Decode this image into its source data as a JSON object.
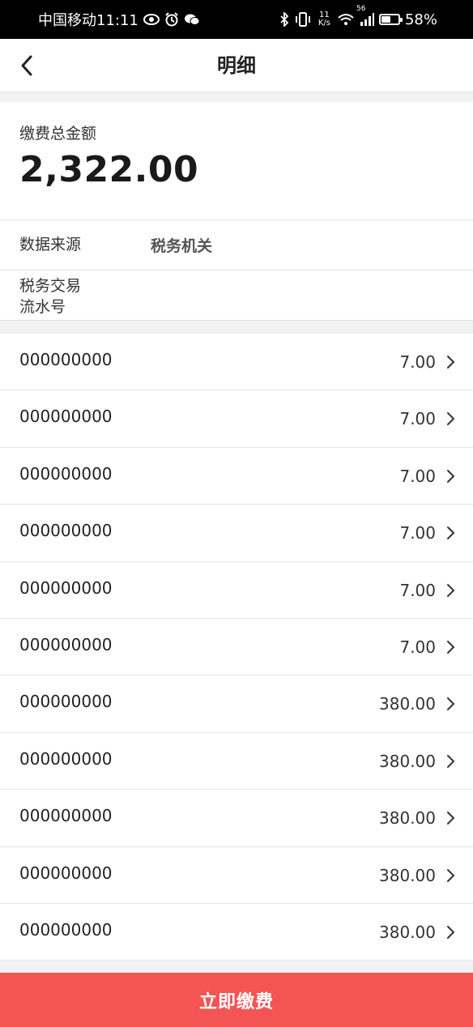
{
  "status_bar": {
    "carrier_time": "中国移动11:11",
    "speed_top": "11",
    "speed_bottom": "K/s",
    "signal_label": "56",
    "battery_percent": "58%",
    "battery_level": 0.58
  },
  "header": {
    "title": "明细"
  },
  "summary": {
    "total_label": "缴费总金额",
    "total_amount": "2,322.00"
  },
  "info": {
    "source_label": "数据来源",
    "source_value": "税务机关",
    "serial_label_line1": "税务交易",
    "serial_label_line2": "流水号",
    "serial_value": ""
  },
  "items": [
    {
      "id": "000000000",
      "amount": "7.00"
    },
    {
      "id": "000000000",
      "amount": "7.00"
    },
    {
      "id": "000000000",
      "amount": "7.00"
    },
    {
      "id": "000000000",
      "amount": "7.00"
    },
    {
      "id": "000000000",
      "amount": "7.00"
    },
    {
      "id": "000000000",
      "amount": "7.00"
    },
    {
      "id": "000000000",
      "amount": "380.00"
    },
    {
      "id": "000000000",
      "amount": "380.00"
    },
    {
      "id": "000000000",
      "amount": "380.00"
    },
    {
      "id": "000000000",
      "amount": "380.00"
    },
    {
      "id": "000000000",
      "amount": "380.00"
    }
  ],
  "footer": {
    "pay_label": "立即缴费"
  },
  "colors": {
    "accent": "#f25553",
    "status_bar": "#000000"
  },
  "icons": [
    "eye-icon",
    "alarm-icon",
    "wechat-icon",
    "bluetooth-icon",
    "vibrate-icon",
    "wifi-icon",
    "signal-icon",
    "battery-icon",
    "back-arrow-icon",
    "chevron-right-icon"
  ]
}
